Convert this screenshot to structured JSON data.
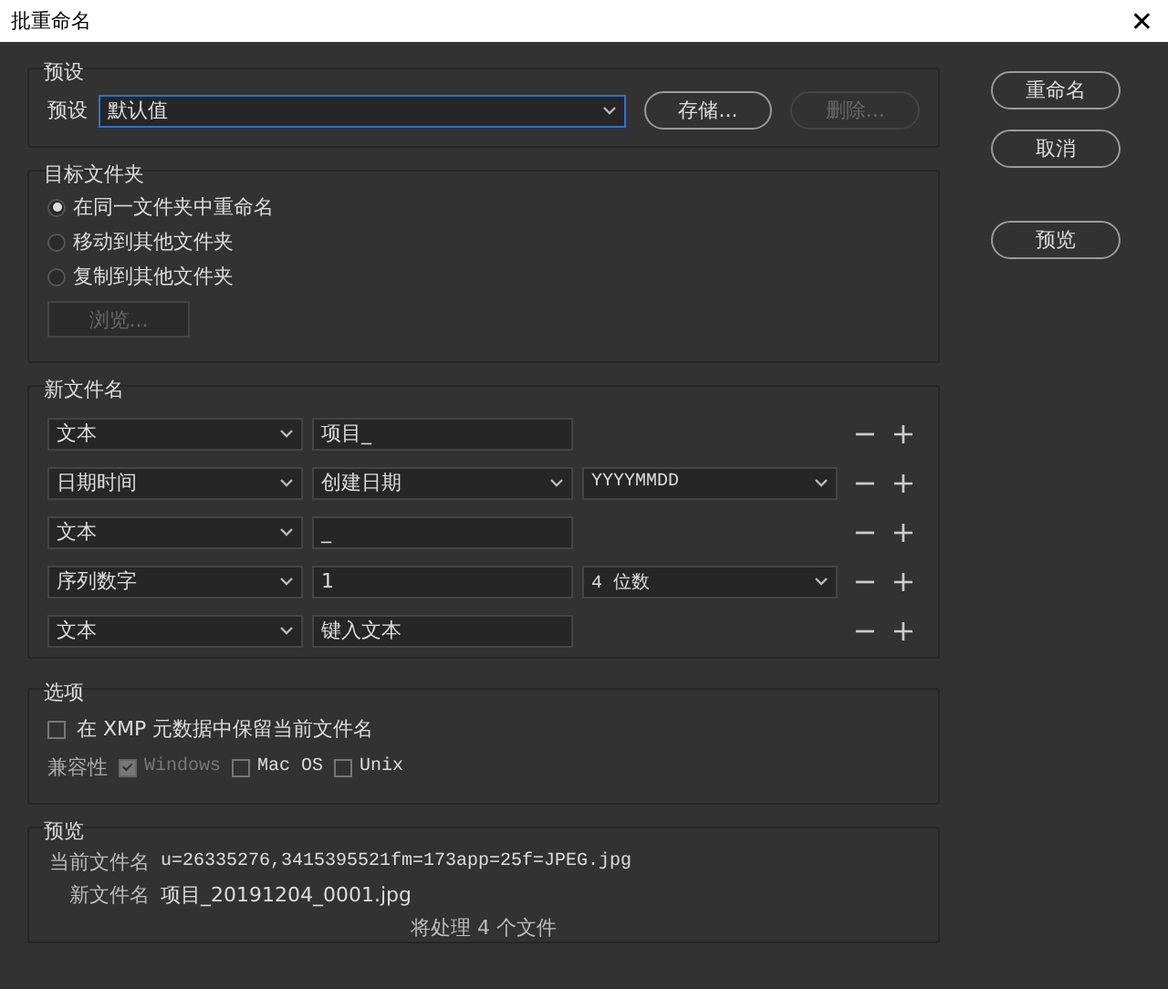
{
  "window": {
    "title": "批重命名",
    "close": "✕"
  },
  "preset_group": {
    "title": "预设",
    "label": "预设",
    "value": "默认值",
    "buttons": [
      {
        "label": "存储...",
        "disabled": false
      },
      {
        "label": "删除...",
        "disabled": true
      }
    ]
  },
  "destination": {
    "title": "目标文件夹",
    "options": [
      {
        "label": "在同一文件夹中重命名",
        "selected": true
      },
      {
        "label": "移动到其他文件夹",
        "selected": false
      },
      {
        "label": "复制到其他文件夹",
        "selected": false
      }
    ],
    "browse": {
      "label": "浏览...",
      "disabled": true
    }
  },
  "new_filename": {
    "title": "新文件名",
    "rows": [
      {
        "type": "文本",
        "field": {
          "kind": "input",
          "value": "项目_"
        }
      },
      {
        "type": "日期时间",
        "field": {
          "kind": "select",
          "value": "创建日期"
        },
        "format": "YYYYMMDD"
      },
      {
        "type": "文本",
        "field": {
          "kind": "input",
          "value": "_"
        }
      },
      {
        "type": "序列数字",
        "field": {
          "kind": "input",
          "value": "1"
        },
        "format": "4 位数"
      },
      {
        "type": "文本",
        "field": {
          "kind": "input",
          "value": "键入文本"
        }
      }
    ],
    "remove": "−",
    "add": "+"
  },
  "options": {
    "title": "选项",
    "keep_xmp": {
      "label": "在 XMP 元数据中保留当前文件名",
      "checked": false
    },
    "compat_label": "兼容性",
    "compat": [
      {
        "label": "Windows",
        "checked": true,
        "disabled": true
      },
      {
        "label": "Mac OS",
        "checked": false,
        "disabled": false
      },
      {
        "label": "Unix",
        "checked": false,
        "disabled": false
      }
    ]
  },
  "preview": {
    "title": "预览",
    "current_label": "当前文件名",
    "current": "u=26335276,3415395521fm=173app=25f=JPEG.jpg",
    "new_label": "新文件名",
    "new": "项目_20191204_0001.jpg",
    "summary": "将处理 4 个文件"
  },
  "actions": [
    {
      "label": "重命名"
    },
    {
      "label": "取消"
    },
    {
      "label": "预览"
    }
  ]
}
